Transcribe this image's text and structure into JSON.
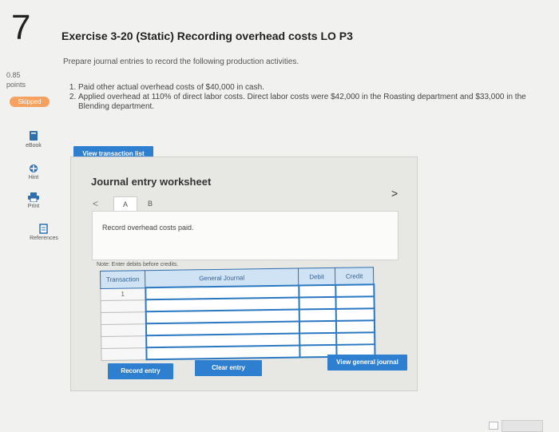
{
  "question": {
    "number": "7",
    "points_value": "0.85",
    "points_label": "points",
    "status": "Skipped"
  },
  "tools": [
    {
      "label": "eBook",
      "icon": "book-icon"
    },
    {
      "label": "Hint",
      "icon": "hint-icon"
    },
    {
      "label": "Print",
      "icon": "print-icon"
    },
    {
      "label": "References",
      "icon": "references-icon"
    }
  ],
  "exercise": {
    "title": "Exercise 3-20 (Static) Recording overhead costs LO P3",
    "instruction": "Prepare journal entries to record the following production activities.",
    "activities": [
      "Paid other actual overhead costs of $40,000 in cash.",
      "Applied overhead at 110% of direct labor costs. Direct labor costs were $42,000 in the Roasting department and $33,000 in the Blending department."
    ]
  },
  "buttons": {
    "view_transactions": "View transaction list",
    "record_entry": "Record entry",
    "clear_entry": "Clear entry",
    "view_journal": "View general journal"
  },
  "worksheet": {
    "title": "Journal entry worksheet",
    "tabs": [
      "A",
      "B"
    ],
    "prev_arrow": "<",
    "next_arrow": ">",
    "prompt": "Record overhead costs paid.",
    "note": "Note: Enter debits before credits.",
    "columns": [
      "Transaction",
      "General Journal",
      "Debit",
      "Credit"
    ],
    "transaction": "1"
  }
}
